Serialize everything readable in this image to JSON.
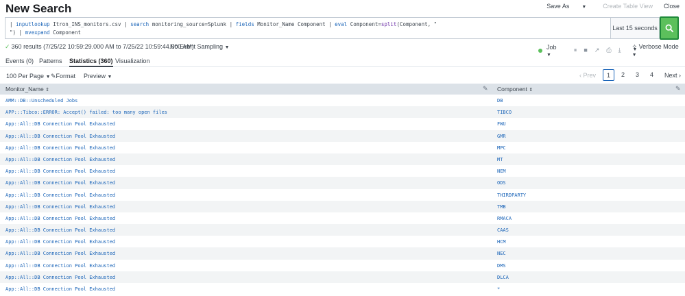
{
  "header": {
    "title": "New Search",
    "save_as": "Save As",
    "create_table_view": "Create Table View",
    "close": "Close"
  },
  "search": {
    "q_pipe1": "| ",
    "q_inputlookup": "inputlookup",
    "q_file": " Itron_INS_monitors.csv | ",
    "q_search": "search",
    "q_cond": " monitoring_source=Splunk | ",
    "q_fields": "fields",
    "q_fieldlist": " Monitor_Name Component | ",
    "q_eval": "eval",
    "q_assign": " Component=",
    "q_split": "split",
    "q_args": "(Component, \"",
    "q_line2a": "\") | ",
    "q_mvexpand": "mvexpand",
    "q_line2b": " Component",
    "time_range": "Last 15 seconds"
  },
  "status": {
    "results_text": "360 results (7/25/22 10:59:29.000 AM to 7/25/22 10:59:44.000 AM)",
    "sampling": "No Event Sampling",
    "job": "Job",
    "mode": "Verbose Mode"
  },
  "tabs": {
    "events": "Events (0)",
    "patterns": "Patterns",
    "statistics": "Statistics (360)",
    "visualization": "Visualization"
  },
  "controls": {
    "per_page": "100 Per Page",
    "format": "Format",
    "preview": "Preview",
    "prev": "Prev",
    "next": "Next",
    "pages": [
      "1",
      "2",
      "3",
      "4"
    ]
  },
  "table": {
    "columns": [
      "Monitor_Name",
      "Component"
    ],
    "rows": [
      [
        "AMM::DB::Unscheduled Jobs",
        "DB"
      ],
      [
        "APP:::Tibco::ERROR: Accept() failed: too many open files",
        "TIBCO"
      ],
      [
        "App::All::DB Connection Pool Exhausted",
        "FWU"
      ],
      [
        "App::All::DB Connection Pool Exhausted",
        "GMR"
      ],
      [
        "App::All::DB Connection Pool Exhausted",
        "MPC"
      ],
      [
        "App::All::DB Connection Pool Exhausted",
        "MT"
      ],
      [
        "App::All::DB Connection Pool Exhausted",
        "NEM"
      ],
      [
        "App::All::DB Connection Pool Exhausted",
        "ODS"
      ],
      [
        "App::All::DB Connection Pool Exhausted",
        "THIRDPARTY"
      ],
      [
        "App::All::DB Connection Pool Exhausted",
        "TMB"
      ],
      [
        "App::All::DB Connection Pool Exhausted",
        "RMACA"
      ],
      [
        "App::All::DB Connection Pool Exhausted",
        "CAAS"
      ],
      [
        "App::All::DB Connection Pool Exhausted",
        "HCM"
      ],
      [
        "App::All::DB Connection Pool Exhausted",
        "NEC"
      ],
      [
        "App::All::DB Connection Pool Exhausted",
        "DMS"
      ],
      [
        "App::All::DB Connection Pool Exhausted",
        "DLCA"
      ],
      [
        "App::All::DB Connection Pool Exhausted",
        "*"
      ]
    ]
  },
  "colors": {
    "accent": "#1a64b8",
    "search_button": "#5cc05c",
    "header_bg": "#dce2e8"
  }
}
